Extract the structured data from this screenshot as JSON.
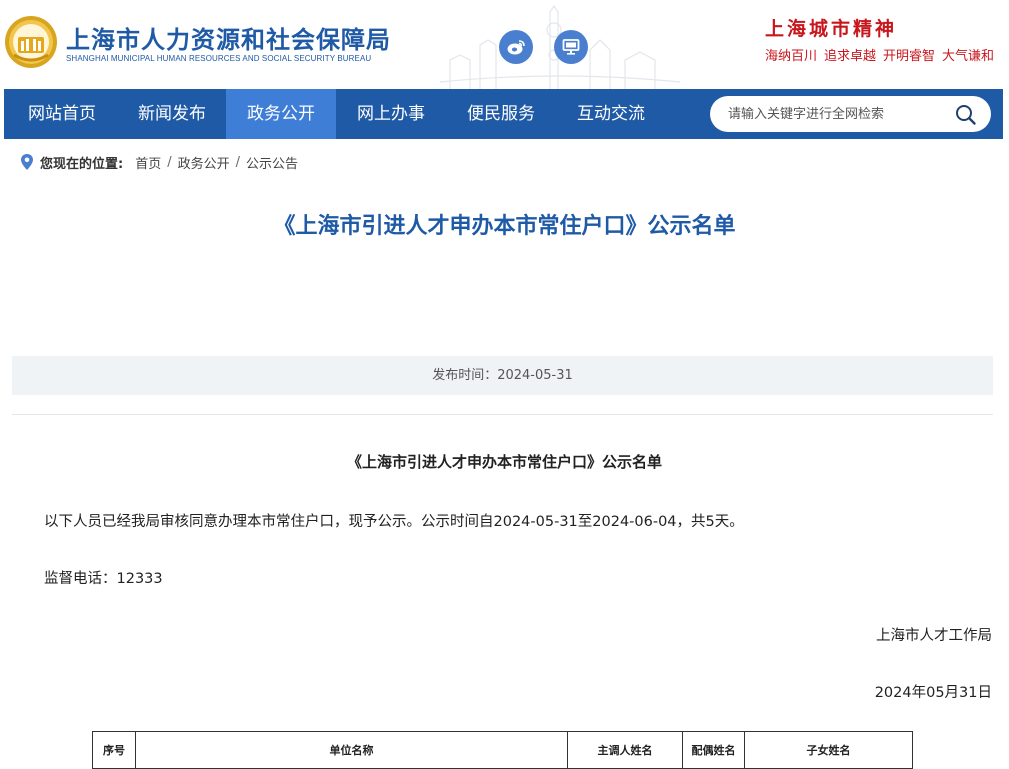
{
  "header": {
    "title": "上海市人力资源和社会保障局",
    "subtitle": "SHANGHAI MUNICIPAL HUMAN RESOURCES AND SOCIAL SECURITY BUREAU",
    "social": {
      "weibo_icon": "weibo-icon",
      "pc_icon": "monitor-icon"
    },
    "spirit": {
      "title": "上海城市精神",
      "words": [
        "海纳百川",
        "追求卓越",
        "开明睿智",
        "大气谦和"
      ]
    }
  },
  "nav": {
    "items": [
      {
        "label": "网站首页"
      },
      {
        "label": "新闻发布"
      },
      {
        "label": "政务公开",
        "active": true
      },
      {
        "label": "网上办事"
      },
      {
        "label": "便民服务"
      },
      {
        "label": "互动交流"
      }
    ],
    "search": {
      "placeholder": "请输入关键字进行全网检索",
      "value": ""
    }
  },
  "breadcrumb": {
    "label": "您现在的位置:",
    "items": [
      "首页",
      "政务公开",
      "公示公告"
    ],
    "separator": "/"
  },
  "article": {
    "title": "《上海市引进人才申办本市常住户口》公示名单",
    "publish": "发布时间：2024-05-31",
    "content_title": "《上海市引进人才申办本市常住户口》公示名单",
    "intro": "以下人员已经我局审核同意办理本市常住户口，现予公示。公示时间自2024-05-31至2024-06-04，共5天。",
    "hotline": "监督电话：12333",
    "issuer": "上海市人才工作局",
    "date": "2024年05月31日"
  },
  "table": {
    "headers": [
      "序号",
      "单位名称",
      "主调人姓名",
      "配偶姓名",
      "子女姓名"
    ]
  },
  "colors": {
    "brand_blue": "#1f5aa6",
    "nav_active": "#3f7ed6",
    "spirit_red": "#c8161d"
  }
}
